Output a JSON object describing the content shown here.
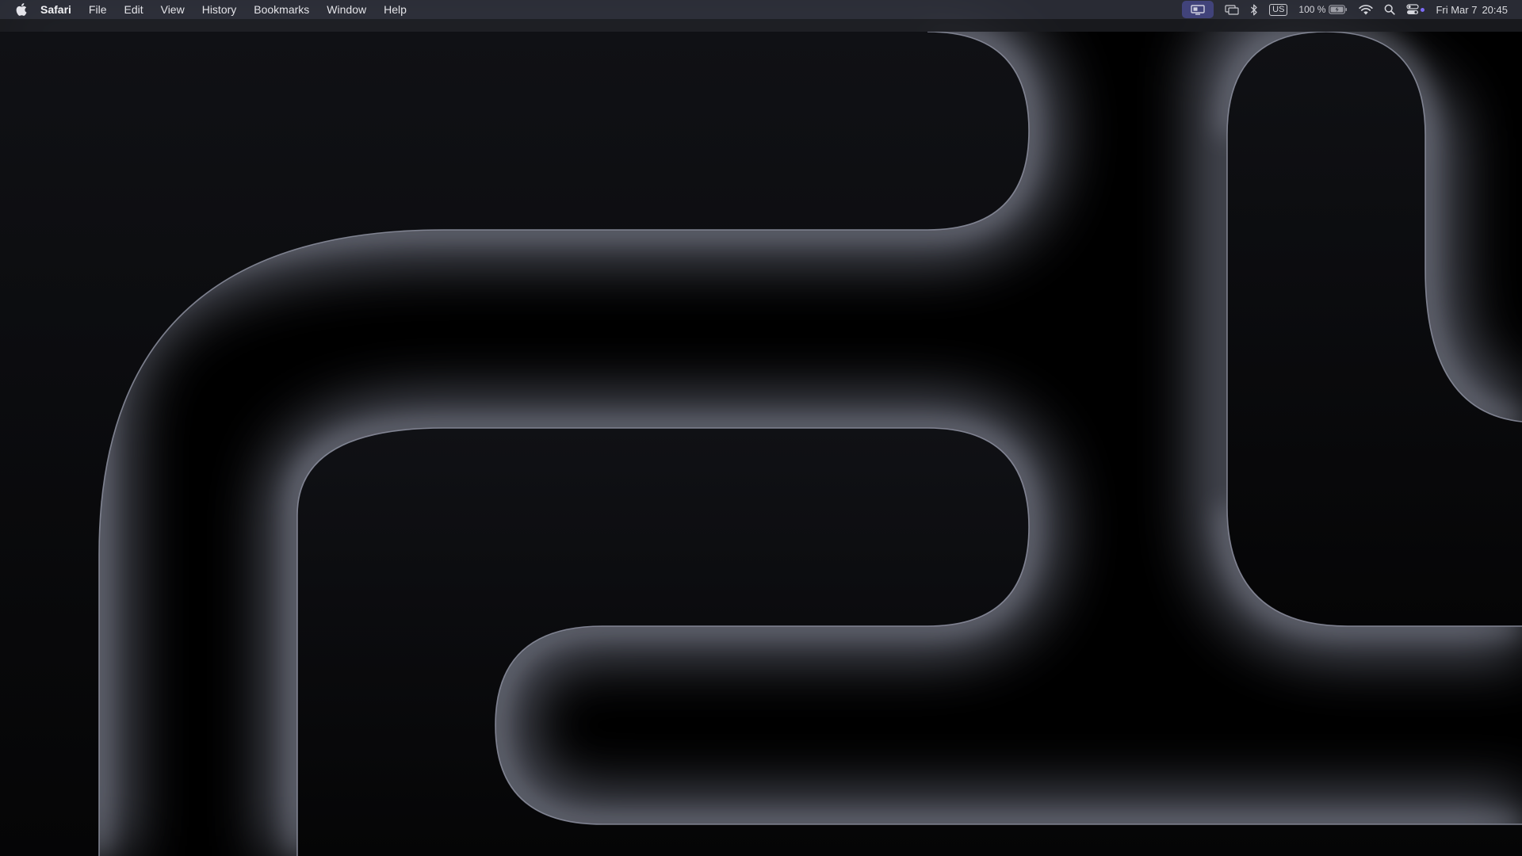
{
  "menubar": {
    "app_name": "Safari",
    "menus": [
      "File",
      "Edit",
      "View",
      "History",
      "Bookmarks",
      "Window",
      "Help"
    ],
    "status": {
      "battery_percent": "100 %",
      "keyboard_layout": "US",
      "date": "Fri Mar 7",
      "time": "20:45"
    }
  },
  "colors": {
    "menubar_bg": "#2c2f38",
    "highlight": "#41437a",
    "wallpaper_base": "#000000",
    "ribbon_glow": "#8a8d9c"
  },
  "icons": [
    "apple-icon",
    "screen-mirroring-icon",
    "display-icon",
    "bluetooth-icon",
    "keyboard-layout-icon",
    "battery-icon",
    "wifi-icon",
    "search-icon",
    "control-center-icon"
  ]
}
